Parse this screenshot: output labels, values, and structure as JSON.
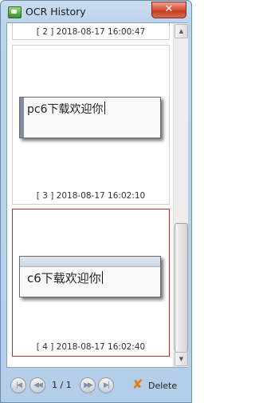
{
  "window": {
    "title": "OCR History",
    "close_symbol": "✕"
  },
  "entries": [
    {
      "caption": "[ 2 ] 2018-08-17 16:00:47"
    },
    {
      "caption": "[ 3 ] 2018-08-17 16:02:10",
      "thumbnail_text": "pc6下载欢迎你"
    },
    {
      "caption": "[ 4 ] 2018-08-17 16:02:40",
      "thumbnail_text": "c6下载欢迎你",
      "selected": true
    }
  ],
  "scrollbar": {
    "up_arrow": "▲",
    "down_arrow": "▼"
  },
  "pager": {
    "first": "|◀",
    "prev": "◀◀",
    "next": "▶▶",
    "last": "▶|",
    "page_label": "1 / 1"
  },
  "delete": {
    "label": "Delete",
    "icon": "✘"
  },
  "colors": {
    "selected_border": "#b3302a",
    "close_button": "#c23f22",
    "delete_icon": "#e8760a"
  }
}
